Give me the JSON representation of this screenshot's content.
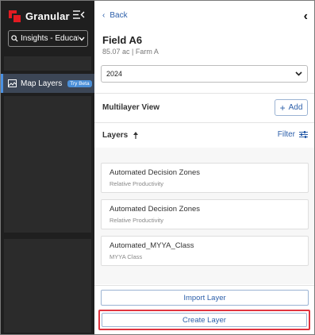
{
  "brand": {
    "name": "Granular"
  },
  "workspace": {
    "label": "Insights - Educatio"
  },
  "nav": {
    "map_layers": {
      "label": "Map Layers",
      "badge": "Try Beta"
    }
  },
  "panel": {
    "back_label": "Back",
    "field": {
      "name": "Field A6",
      "subtitle": "85.07 ac | Farm A"
    },
    "year": {
      "selected": "2024"
    },
    "multilayer": {
      "title": "Multilayer View",
      "add_label": "Add"
    },
    "layers": {
      "title": "Layers",
      "filter_label": "Filter",
      "items": [
        {
          "name": "Automated Decision Zones",
          "type": "Relative Productivity"
        },
        {
          "name": "Automated Decision Zones",
          "type": "Relative Productivity"
        },
        {
          "name": "Automated_MYYA_Class",
          "type": "MYYA Class"
        }
      ]
    },
    "actions": {
      "import_label": "Import Layer",
      "create_label": "Create Layer"
    }
  },
  "colors": {
    "accent": "#2c5faa",
    "brand_red": "#e21b22",
    "sidebar_bg": "#1f1f1f",
    "highlight": "#e0343f"
  },
  "icons": [
    "collapse-sidebar-icon",
    "search-icon",
    "chevron-down-icon",
    "map-layers-icon",
    "chevron-left-icon",
    "sort-icon",
    "filter-icon",
    "plus-icon"
  ]
}
